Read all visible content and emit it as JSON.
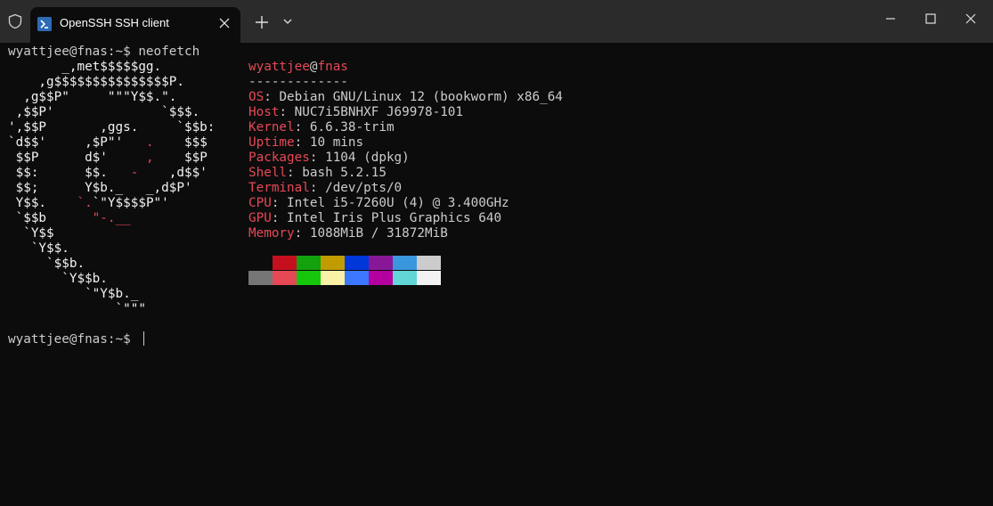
{
  "tab": {
    "title": "OpenSSH SSH client"
  },
  "terminal": {
    "prompt_line": "wyattjee@fnas:~$ neofetch",
    "logo_lines": [
      [
        {
          "t": "       _,met$$$$$gg.",
          "c": "white"
        }
      ],
      [
        {
          "t": "    ,g$$$$$$$$$$$$$$$P.",
          "c": "white"
        }
      ],
      [
        {
          "t": "  ,g$$P\"     \"\"\"Y$$.\".",
          "c": "white"
        }
      ],
      [
        {
          "t": " ,$$P'              `$$$.",
          "c": "white"
        }
      ],
      [
        {
          "t": "',$$P       ,ggs.     `$$b:",
          "c": "white"
        }
      ],
      [
        {
          "t": "`d$$'     ,$P\"'   ",
          "c": "white"
        },
        {
          "t": ".",
          "c": "red"
        },
        {
          "t": "    $$$",
          "c": "white"
        }
      ],
      [
        {
          "t": " $$P      d$'     ",
          "c": "white"
        },
        {
          "t": ",",
          "c": "red"
        },
        {
          "t": "    $$P",
          "c": "white"
        }
      ],
      [
        {
          "t": " $$:      $$.   ",
          "c": "white"
        },
        {
          "t": "-",
          "c": "red"
        },
        {
          "t": "    ,d$$'",
          "c": "white"
        }
      ],
      [
        {
          "t": " $$;      Y$b._   _,d$P'",
          "c": "white"
        }
      ],
      [
        {
          "t": " Y$$.    ",
          "c": "white"
        },
        {
          "t": "`.",
          "c": "red"
        },
        {
          "t": "`\"Y$$$$P\"'",
          "c": "white"
        }
      ],
      [
        {
          "t": " `$$b      ",
          "c": "white"
        },
        {
          "t": "\"-.__",
          "c": "red"
        }
      ],
      [
        {
          "t": "  `Y$$",
          "c": "white"
        }
      ],
      [
        {
          "t": "   `Y$$.",
          "c": "white"
        }
      ],
      [
        {
          "t": "     `$$b.",
          "c": "white"
        }
      ],
      [
        {
          "t": "       `Y$$b.",
          "c": "white"
        }
      ],
      [
        {
          "t": "          `\"Y$b._",
          "c": "white"
        }
      ],
      [
        {
          "t": "              `\"\"\"",
          "c": "white"
        }
      ]
    ],
    "user": "wyattjee",
    "at": "@",
    "host": "fnas",
    "separator": "-------------",
    "info": [
      {
        "key": "OS",
        "value": "Debian GNU/Linux 12 (bookworm) x86_64"
      },
      {
        "key": "Host",
        "value": "NUC7i5BNHXF J69978-101"
      },
      {
        "key": "Kernel",
        "value": "6.6.38-trim"
      },
      {
        "key": "Uptime",
        "value": "10 mins"
      },
      {
        "key": "Packages",
        "value": "1104 (dpkg)"
      },
      {
        "key": "Shell",
        "value": "bash 5.2.15"
      },
      {
        "key": "Terminal",
        "value": "/dev/pts/0"
      },
      {
        "key": "CPU",
        "value": "Intel i5-7260U (4) @ 3.400GHz"
      },
      {
        "key": "GPU",
        "value": "Intel Iris Plus Graphics 640"
      },
      {
        "key": "Memory",
        "value": "1088MiB / 31872MiB"
      }
    ],
    "info_sep": ": ",
    "palette_top": [
      "#0c0c0c",
      "#c50f1f",
      "#13a10e",
      "#c19c00",
      "#0037da",
      "#881798",
      "#3a96dd",
      "#cccccc"
    ],
    "palette_bottom": [
      "#767676",
      "#e74856",
      "#16c60c",
      "#f9f1a5",
      "#3b78ff",
      "#b4009e",
      "#61d6d6",
      "#f2f2f2"
    ],
    "final_prompt": "wyattjee@fnas:~$ "
  },
  "colors": {
    "accent_red": "#e74856",
    "text": "#cccccc",
    "background": "#0c0c0c",
    "titlebar": "#2b2b2b"
  },
  "icons": {
    "shield": "shield-icon",
    "tab_app": "powershell-icon",
    "tab_close": "close-icon",
    "new_tab": "plus-icon",
    "dropdown": "chevron-down-icon",
    "minimize": "minimize-icon",
    "maximize": "maximize-icon",
    "close": "close-icon"
  }
}
